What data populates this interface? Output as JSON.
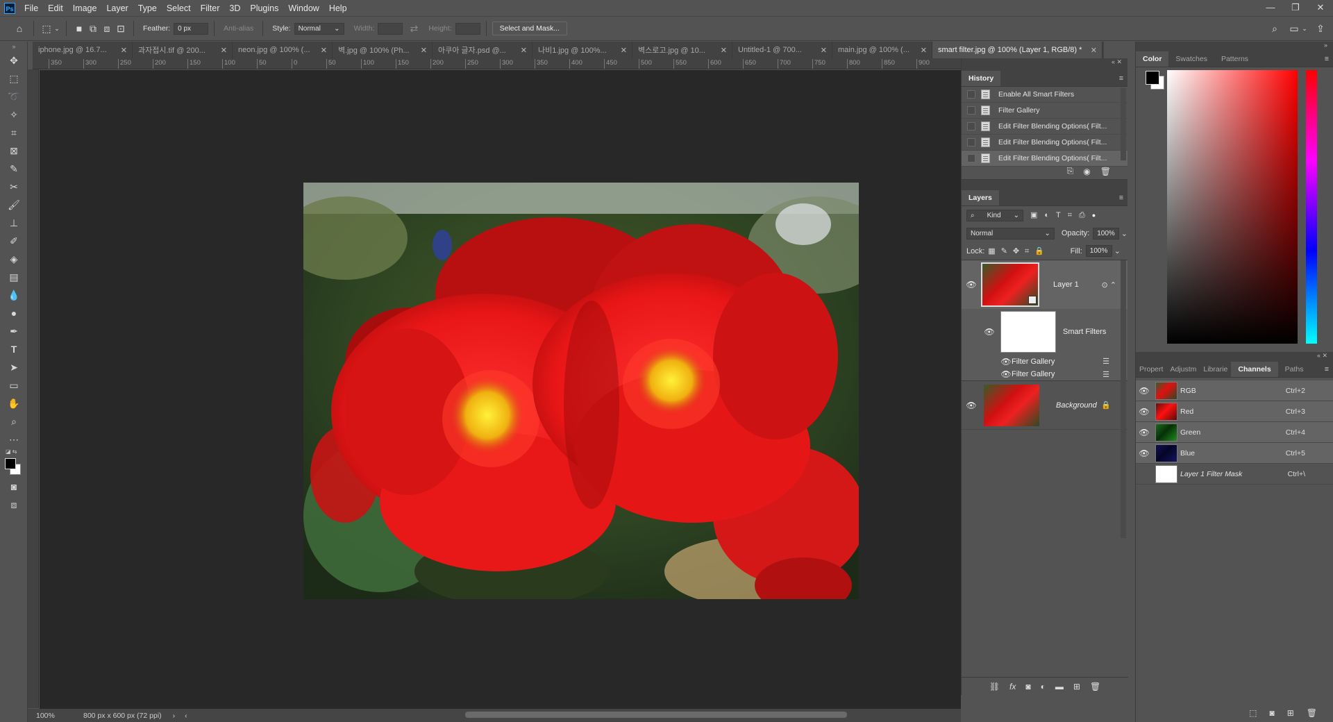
{
  "app": {
    "logo": "Ps"
  },
  "menu": [
    "File",
    "Edit",
    "Image",
    "Layer",
    "Type",
    "Select",
    "Filter",
    "3D",
    "Plugins",
    "Window",
    "Help"
  ],
  "window_controls": {
    "minimize": "—",
    "restore": "❐",
    "close": "✕"
  },
  "options": {
    "feather_label": "Feather:",
    "feather_value": "0 px",
    "anti_alias": "Anti-alias",
    "style_label": "Style:",
    "style_value": "Normal",
    "width_label": "Width:",
    "height_label": "Height:",
    "select_mask": "Select and Mask..."
  },
  "tabs": [
    {
      "label": "iphone.jpg @ 16.7..."
    },
    {
      "label": "과자접시.tif @ 200..."
    },
    {
      "label": "neon.jpg @ 100% (..."
    },
    {
      "label": "벽.jpg @ 100% (Ph..."
    },
    {
      "label": "아쿠아 글자.psd @..."
    },
    {
      "label": "나비1.jpg @ 100%..."
    },
    {
      "label": "벽스로고.jpg @ 10..."
    },
    {
      "label": "Untitled-1 @ 700..."
    },
    {
      "label": "main.jpg @ 100% (..."
    },
    {
      "label": "smart filter.jpg @ 100% (Layer 1, RGB/8) *"
    }
  ],
  "ruler_top": [
    "350",
    "300",
    "250",
    "200",
    "150",
    "100",
    "50",
    "0",
    "50",
    "100",
    "150",
    "200",
    "250",
    "300",
    "350",
    "400",
    "450",
    "500",
    "550",
    "600",
    "650",
    "700",
    "750",
    "800",
    "850",
    "900"
  ],
  "status": {
    "zoom": "100%",
    "doc_info": "800 px x 600 px (72 ppi)"
  },
  "history": {
    "title": "History",
    "items": [
      "Enable All Smart Filters",
      "Filter Gallery",
      "Edit Filter Blending Options( Filt...",
      "Edit Filter Blending Options( Filt...",
      "Edit Filter Blending Options( Filt..."
    ]
  },
  "layers": {
    "title": "Layers",
    "kind": "Kind",
    "blend_mode": "Normal",
    "opacity_label": "Opacity:",
    "opacity": "100%",
    "lock_label": "Lock:",
    "fill_label": "Fill:",
    "fill": "100%",
    "layer1": "Layer 1",
    "smart_filters": "Smart Filters",
    "filter1": "Filter Gallery",
    "filter2": "Filter Gallery",
    "background": "Background"
  },
  "color_panel": {
    "tabs": [
      "Color",
      "Swatches",
      "Patterns"
    ]
  },
  "channels_panel": {
    "tabs": [
      "Propert",
      "Adjustm",
      "Librarie",
      "Channels",
      "Paths"
    ],
    "rows": [
      {
        "name": "RGB",
        "shortcut": "Ctrl+2"
      },
      {
        "name": "Red",
        "shortcut": "Ctrl+3"
      },
      {
        "name": "Green",
        "shortcut": "Ctrl+4"
      },
      {
        "name": "Blue",
        "shortcut": "Ctrl+5"
      },
      {
        "name": "Layer 1 Filter Mask",
        "shortcut": "Ctrl+\\"
      }
    ]
  },
  "colors": {
    "fg": "#000000",
    "bg": "#ffffff",
    "accent": "#31a8ff"
  }
}
